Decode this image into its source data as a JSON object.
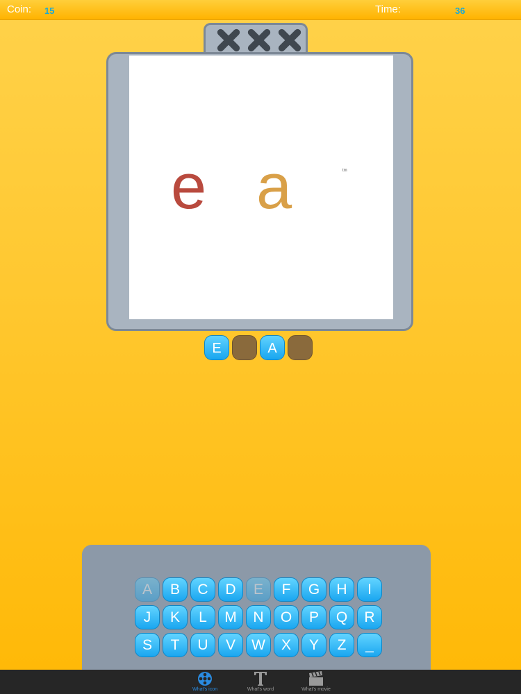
{
  "status": {
    "coin_label": "Coin:",
    "coin_value": "15",
    "time_label": "Time:",
    "time_value": "36"
  },
  "strikes": {
    "count": 3,
    "icon": "x-strike-icon"
  },
  "puzzle": {
    "letters": [
      {
        "char": "e",
        "color": "#b94a3e"
      },
      {
        "char": "a",
        "color": "#d9a048"
      }
    ],
    "trademark": "tm"
  },
  "answer": {
    "slots": [
      {
        "letter": "E",
        "state": "filled"
      },
      {
        "letter": "",
        "state": "empty"
      },
      {
        "letter": "A",
        "state": "filled"
      },
      {
        "letter": "",
        "state": "empty"
      }
    ]
  },
  "keyboard": {
    "rows": [
      [
        "A",
        "B",
        "C",
        "D",
        "E",
        "F",
        "G",
        "H",
        "I"
      ],
      [
        "J",
        "K",
        "L",
        "M",
        "N",
        "O",
        "P",
        "Q",
        "R"
      ],
      [
        "S",
        "T",
        "U",
        "V",
        "W",
        "X",
        "Y",
        "Z",
        "_"
      ]
    ],
    "used": [
      "A",
      "E"
    ]
  },
  "tabs": [
    {
      "label": "What's icon",
      "icon": "film-reel-icon",
      "active": true
    },
    {
      "label": "What's word",
      "icon": "text-t-icon",
      "active": false
    },
    {
      "label": "What's movie",
      "icon": "clapperboard-icon",
      "active": false
    }
  ]
}
